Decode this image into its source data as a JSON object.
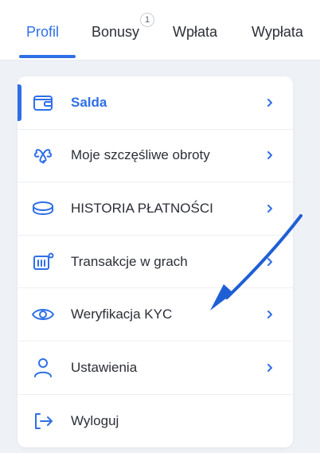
{
  "tabs": [
    {
      "label": "Profil",
      "active": true
    },
    {
      "label": "Bonusy",
      "badge": "1"
    },
    {
      "label": "Wpłata"
    },
    {
      "label": "Wypłata"
    }
  ],
  "menu": [
    {
      "label": "Salda",
      "icon": "wallet-icon",
      "active": true,
      "chevron": true
    },
    {
      "label": "Moje szczęśliwe obroty",
      "icon": "clover-icon",
      "chevron": true
    },
    {
      "label": "HISTORIA PŁATNOŚCI",
      "icon": "coin-icon",
      "chevron": true
    },
    {
      "label": "Transakcje w grach",
      "icon": "game-stats-icon",
      "chevron": true
    },
    {
      "label": "Weryfikacja KYC",
      "icon": "eye-icon",
      "chevron": true
    },
    {
      "label": "Ustawienia",
      "icon": "user-icon",
      "chevron": true
    },
    {
      "label": "Wyloguj",
      "icon": "logout-icon",
      "chevron": false
    }
  ],
  "colors": {
    "accent": "#2f6fe6",
    "text": "#2b2f36",
    "background": "#eef1f6",
    "annotation_arrow": "#1f5fd6"
  }
}
